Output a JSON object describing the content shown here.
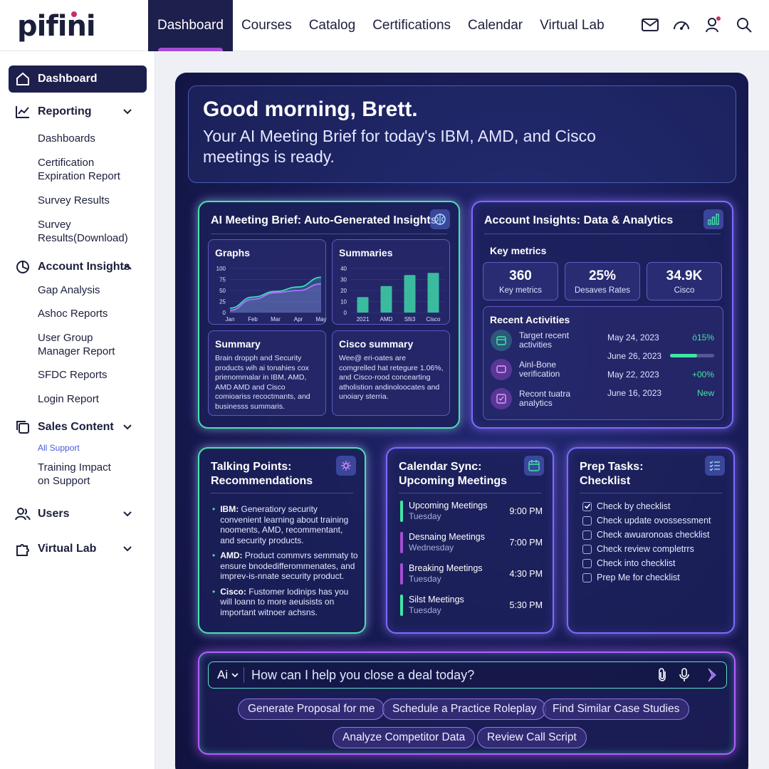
{
  "brand": {
    "logo_text": "pifini"
  },
  "nav": {
    "tabs": [
      "Dashboard",
      "Courses",
      "Catalog",
      "Certifications",
      "Calendar",
      "Virtual Lab"
    ],
    "active": "Dashboard"
  },
  "topicons": [
    "mail-icon",
    "gauge-icon",
    "user-icon",
    "search-icon"
  ],
  "sidebar": {
    "dashboard": "Dashboard",
    "reporting": "Reporting",
    "reporting_items": [
      "Dashboards",
      "Certification Expiration Report",
      "Survey Results",
      "Survey Results(Download)"
    ],
    "account_insights": "Account Insights",
    "account_items": [
      "Gap Analysis",
      "Ashoc Reports",
      "User Group Manager Report",
      "SFDC Reports",
      "Login Report"
    ],
    "sales_content": "Sales Content",
    "sales_items": [
      "All Support",
      "Training Impact on Support"
    ],
    "users": "Users",
    "virtual_lab": "Virtual Lab"
  },
  "greeting": {
    "title": "Good morning, Brett.",
    "subtitle": "Your AI Meeting Brief for today's IBM, AMD, and Cisco meetings is ready."
  },
  "brief": {
    "title": "AI Meeting Brief: Auto-Generated Insights",
    "graphs_title": "Graphs",
    "summaries_title": "Summaries",
    "summary_title": "Summary",
    "summary_text": "Brain dropph and Security products wih ai tonahies cox prienommalar in IBM, AMD, AMD AMD and Cisco comioariss recoctmants, and businesss summaris.",
    "cisco_title": "Cisco summary",
    "cisco_text": "Wee@ eri-oates are comgrelled hat retegure 1.06%, and Cisco-rood concearting atholistion andinoloocates and unoiary sterria."
  },
  "chart_data": [
    {
      "type": "area",
      "title": "Graphs",
      "categories": [
        "Jan",
        "Feb",
        "Mar",
        "Apr",
        "May"
      ],
      "series": [
        {
          "values": [
            10,
            35,
            48,
            58,
            80
          ],
          "color": "#3fd6c0"
        },
        {
          "values": [
            5,
            30,
            45,
            50,
            65
          ],
          "color": "#b070ff"
        }
      ],
      "ylim": [
        0,
        100
      ],
      "yticks": [
        0,
        25,
        50,
        75,
        100
      ]
    },
    {
      "type": "bar",
      "title": "Summaries",
      "categories": [
        "2021",
        "AMD",
        "Sfii3",
        "Cisco"
      ],
      "values": [
        14,
        24,
        34,
        36
      ],
      "ylim": [
        0,
        40
      ],
      "yticks": [
        0,
        10,
        20,
        30,
        40
      ]
    }
  ],
  "insights": {
    "title": "Account Insights: Data & Analytics",
    "key_metrics_label": "Key metrics",
    "metrics": [
      {
        "value": "360",
        "label": "Key metrics"
      },
      {
        "value": "25%",
        "label": "Desaves Rates"
      },
      {
        "value": "34.9K",
        "label": "Cisco"
      }
    ],
    "recent_title": "Recent Activities",
    "activities": [
      {
        "text": "Target recent activities",
        "date": "May 24, 2023",
        "stat": "ö15%"
      },
      {
        "text": "Ainl-Bone verification",
        "date": "June 26, 2023",
        "stat": "",
        "progress": 0.62
      },
      {
        "text": "Recont tuatra analytics",
        "date": "May 22, 2023",
        "stat": "+00%"
      },
      {
        "text": "",
        "date": "June 16, 2023",
        "stat": "New"
      }
    ]
  },
  "talking": {
    "title": "Talking Points: Recommendations",
    "points": [
      {
        "company": "IBM:",
        "text": "Generatiory security convenient learning about training nooments, AMD, recommentant, and security products."
      },
      {
        "company": "AMD:",
        "text": "Product commvrs semmaty to ensure bnodedifferommenates, and imprev-is-nnate security product."
      },
      {
        "company": "Cisco:",
        "text": "Fustomer lodinips has you will loann to more aeuisists on important witnoer achsns."
      }
    ]
  },
  "calendar": {
    "title": "Calendar Sync: Upcoming Meetings",
    "meetings": [
      {
        "name": "Upcoming Meetings",
        "day": "Tuesday",
        "time": "9:00 PM",
        "color": "#41e6a4"
      },
      {
        "name": "Desnaing Meetings",
        "day": "Wednesday",
        "time": "7:00 PM",
        "color": "#a64dd6"
      },
      {
        "name": "Breaking Meetings",
        "day": "Tuesday",
        "time": "4:30 PM",
        "color": "#a64dd6"
      },
      {
        "name": "Silst Meetings",
        "day": "Tuesday",
        "time": "5:30 PM",
        "color": "#41e6a4"
      }
    ]
  },
  "prep": {
    "title": "Prep Tasks: Checklist",
    "items": [
      {
        "label": "Check by checklist",
        "checked": true
      },
      {
        "label": "Check update ovossessment",
        "checked": false
      },
      {
        "label": "Check awuaronoas checklist",
        "checked": false
      },
      {
        "label": "Check review completrrs",
        "checked": false
      },
      {
        "label": "Check into checklist",
        "checked": false
      },
      {
        "label": "Prep Me for checklist",
        "checked": false
      }
    ]
  },
  "assistant": {
    "mode": "Ai",
    "placeholder": "How can I help you close a deal today?",
    "chips": [
      "Generate Proposal for me",
      "Schedule a Practice Roleplay",
      "Find Similar Case Studies",
      "Analyze Competitor Data",
      "Review Call Script"
    ]
  }
}
